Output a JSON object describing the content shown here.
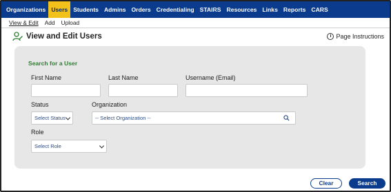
{
  "topnav": {
    "items": [
      "Organizations",
      "Users",
      "Students",
      "Admins",
      "Orders",
      "Credentialing",
      "STAIRS",
      "Resources",
      "Links",
      "Reports",
      "CARS"
    ],
    "active": "Users"
  },
  "subnav": {
    "items": [
      "View & Edit",
      "Add",
      "Upload"
    ],
    "active": "View & Edit"
  },
  "page": {
    "title": "View and Edit Users",
    "instructions": "Page Instructions",
    "icon": "user-edit-icon"
  },
  "search": {
    "title": "Search for a User",
    "first_name_label": "First Name",
    "first_name_value": "",
    "last_name_label": "Last Name",
    "last_name_value": "",
    "username_label": "Username (Email)",
    "username_value": "",
    "status_label": "Status",
    "status_value": "Select Status",
    "organization_label": "Organization",
    "organization_value": "-- Select Organization --",
    "role_label": "Role",
    "role_value": "Select Role"
  },
  "buttons": {
    "clear": "Clear",
    "search": "Search"
  },
  "colors": {
    "nav_bg": "#0a3b8c",
    "nav_active": "#f2c21a",
    "panel_bg": "#e7e7e7",
    "panel_title": "#2e7d32"
  }
}
